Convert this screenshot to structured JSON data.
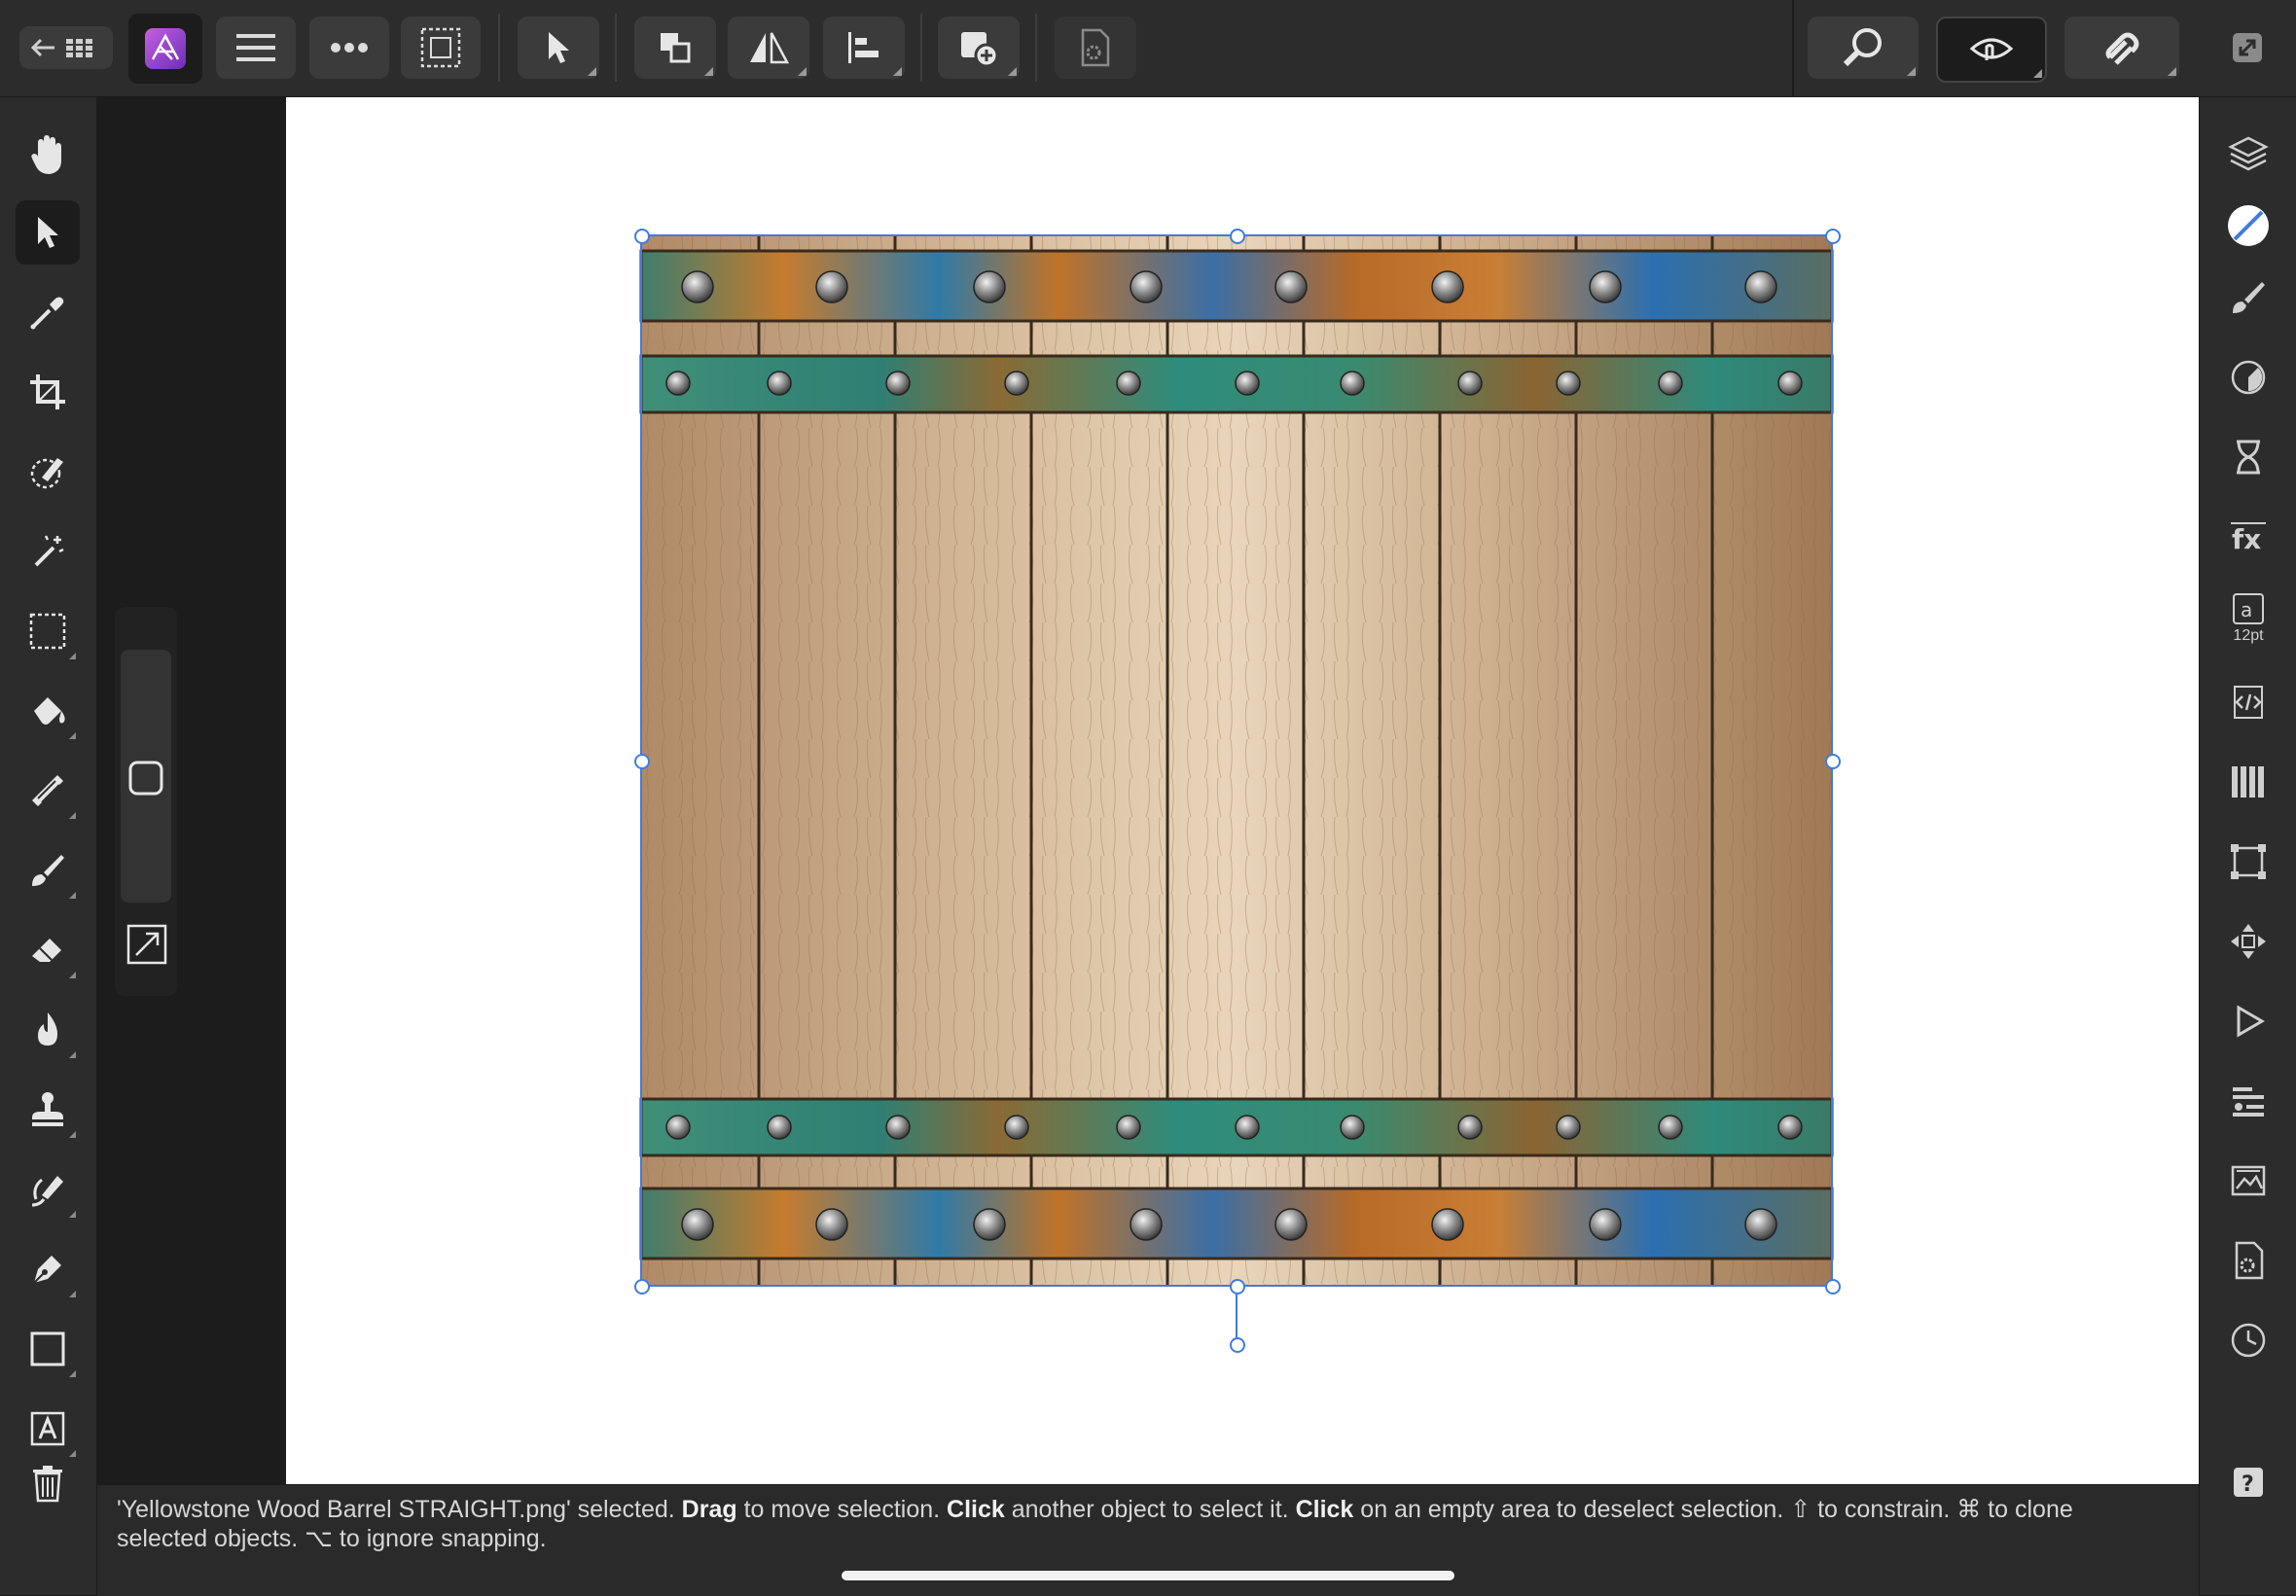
{
  "app": {
    "name": "Affinity Photo"
  },
  "toolbar": {
    "left_buttons": [
      {
        "name": "back-to-documents-button",
        "icon": "arrow-left-grid-icon"
      },
      {
        "name": "persona-photo-button",
        "icon": "affinity-photo-logo-icon"
      },
      {
        "name": "menu-button",
        "icon": "hamburger-menu-icon"
      },
      {
        "name": "more-button",
        "icon": "ellipsis-icon"
      },
      {
        "name": "selection-mode-button",
        "icon": "dashed-selection-icon"
      },
      {
        "name": "move-tool-options-button",
        "icon": "pointer-icon"
      },
      {
        "name": "arrange-button",
        "icon": "arrange-icon"
      },
      {
        "name": "flip-button",
        "icon": "flip-icon"
      },
      {
        "name": "align-button",
        "icon": "align-left-icon"
      },
      {
        "name": "add-layer-button",
        "icon": "add-layer-icon"
      },
      {
        "name": "document-settings-button",
        "icon": "document-gear-icon"
      }
    ],
    "right_buttons": [
      {
        "name": "zoom-button",
        "icon": "magnifier-icon"
      },
      {
        "name": "view-mode-button",
        "icon": "eye-hand-icon"
      },
      {
        "name": "snapping-button",
        "icon": "magnet-icon"
      },
      {
        "name": "fullscreen-button",
        "icon": "expand-icon"
      }
    ]
  },
  "left_tools": [
    {
      "name": "view-tool",
      "icon": "hand-icon"
    },
    {
      "name": "move-tool",
      "icon": "arrow-cursor-icon",
      "selected": true
    },
    {
      "name": "color-picker-tool",
      "icon": "eyedropper-icon"
    },
    {
      "name": "crop-tool",
      "icon": "crop-icon"
    },
    {
      "name": "selection-brush-tool",
      "icon": "selection-brush-icon"
    },
    {
      "name": "flood-select-tool",
      "icon": "magic-wand-icon"
    },
    {
      "name": "marquee-tool",
      "icon": "dashed-rectangle-icon"
    },
    {
      "name": "flood-fill-tool",
      "icon": "paint-bucket-icon"
    },
    {
      "name": "gradient-tool",
      "icon": "gradient-icon"
    },
    {
      "name": "paint-brush-tool",
      "icon": "brush-icon"
    },
    {
      "name": "erase-tool",
      "icon": "eraser-icon"
    },
    {
      "name": "dodge-tool",
      "icon": "flame-icon"
    },
    {
      "name": "clone-tool",
      "icon": "stamp-icon"
    },
    {
      "name": "healing-tool",
      "icon": "healing-brush-icon"
    },
    {
      "name": "pen-tool",
      "icon": "pen-nib-icon"
    },
    {
      "name": "rectangle-tool",
      "icon": "rectangle-icon"
    },
    {
      "name": "text-tool",
      "icon": "text-frame-icon"
    },
    {
      "name": "delete-tool",
      "icon": "trash-icon"
    }
  ],
  "right_panels": [
    {
      "name": "layers-panel-button",
      "icon": "layers-icon"
    },
    {
      "name": "color-panel-button",
      "icon": "color-swatch-icon"
    },
    {
      "name": "brushes-panel-button",
      "icon": "brush-icon"
    },
    {
      "name": "adjustments-panel-button",
      "icon": "adjustment-circle-icon"
    },
    {
      "name": "history-panel-button",
      "icon": "hourglass-icon"
    },
    {
      "name": "effects-panel-button",
      "icon": "fx-icon"
    },
    {
      "name": "character-panel-button",
      "icon": "character-icon",
      "label": "12pt"
    },
    {
      "name": "source-panel-button",
      "icon": "code-icon"
    },
    {
      "name": "channels-panel-button",
      "icon": "channels-icon"
    },
    {
      "name": "transform-panel-button",
      "icon": "transform-box-icon"
    },
    {
      "name": "navigator-panel-button",
      "icon": "move-arrows-icon"
    },
    {
      "name": "macro-panel-button",
      "icon": "play-icon"
    },
    {
      "name": "info-panel-button",
      "icon": "info-list-icon"
    },
    {
      "name": "stock-panel-button",
      "icon": "stock-image-icon"
    },
    {
      "name": "document-panel-button",
      "icon": "document-gear-icon"
    },
    {
      "name": "snapshots-panel-button",
      "icon": "snapshot-clock-icon"
    },
    {
      "name": "help-button",
      "icon": "question-icon"
    }
  ],
  "status": {
    "p1": "'Yellowstone Wood Barrel STRAIGHT.png' selected. ",
    "b1": "Drag",
    "p2": " to move selection. ",
    "b2": "Click",
    "p3": " another object to select it. ",
    "b3": "Click",
    "p4": " on an empty area to deselect selection. ⇧ to constrain. ⌘ to clone selected objects. ⌥ to ignore snapping."
  },
  "colors": {
    "selection_handle": "#3f7be0",
    "app_bg": "#2c2c2c",
    "canvas_page": "#ffffff"
  }
}
